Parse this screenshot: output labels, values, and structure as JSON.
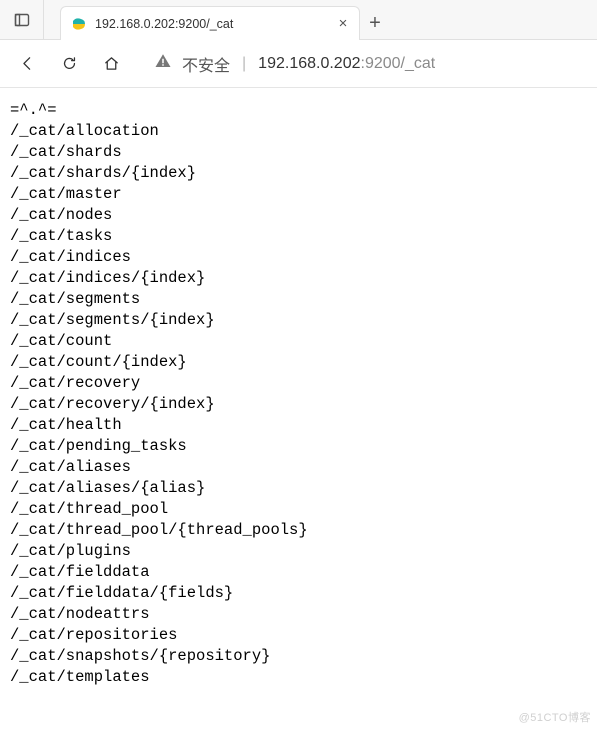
{
  "tab": {
    "title": "192.168.0.202:9200/_cat",
    "close_glyph": "×",
    "newtab_glyph": "+"
  },
  "toolbar": {
    "insecure_label": "不安全",
    "pipe": "|",
    "url_host": "192.168.0.202",
    "url_port": ":9200",
    "url_path": "/_cat"
  },
  "content_lines": [
    "=^.^=",
    "/_cat/allocation",
    "/_cat/shards",
    "/_cat/shards/{index}",
    "/_cat/master",
    "/_cat/nodes",
    "/_cat/tasks",
    "/_cat/indices",
    "/_cat/indices/{index}",
    "/_cat/segments",
    "/_cat/segments/{index}",
    "/_cat/count",
    "/_cat/count/{index}",
    "/_cat/recovery",
    "/_cat/recovery/{index}",
    "/_cat/health",
    "/_cat/pending_tasks",
    "/_cat/aliases",
    "/_cat/aliases/{alias}",
    "/_cat/thread_pool",
    "/_cat/thread_pool/{thread_pools}",
    "/_cat/plugins",
    "/_cat/fielddata",
    "/_cat/fielddata/{fields}",
    "/_cat/nodeattrs",
    "/_cat/repositories",
    "/_cat/snapshots/{repository}",
    "/_cat/templates"
  ],
  "watermark": "@51CTO博客"
}
